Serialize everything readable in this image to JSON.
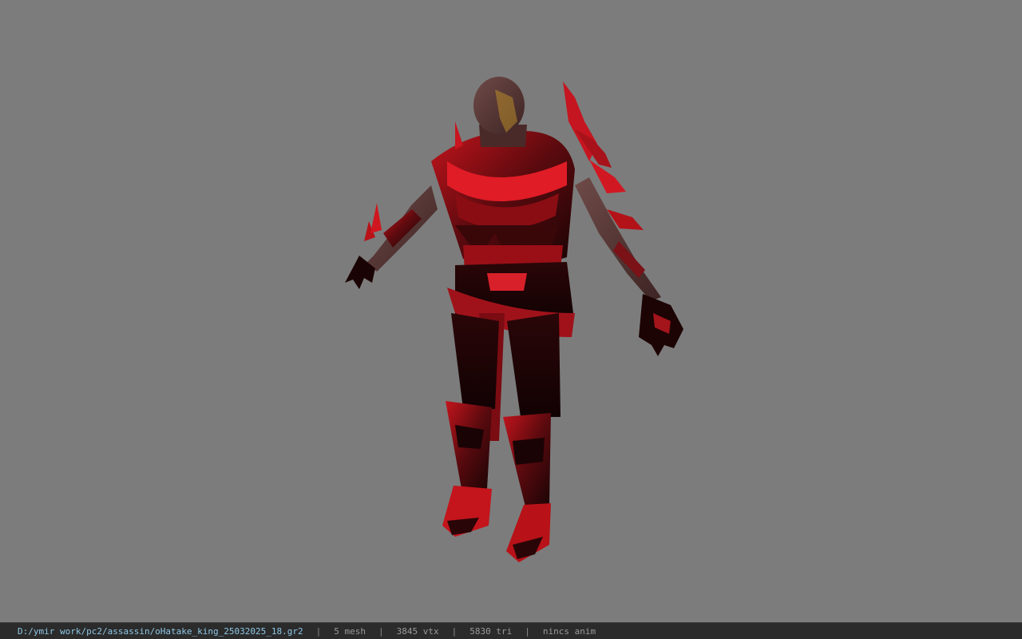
{
  "viewer": {
    "background_color": "#7c7c7c",
    "model_name": "oHatake_king"
  },
  "statusbar": {
    "file_path": "D:/ymir work/pc2/assassin/oHatake_king_25032025_18.gr2",
    "separator": "|",
    "mesh_count": "5 mesh",
    "vertex_count": "3845 vtx",
    "triangle_count": "5830 tri",
    "anim_status": "nincs anim",
    "path_color": "#8ec7e6"
  }
}
